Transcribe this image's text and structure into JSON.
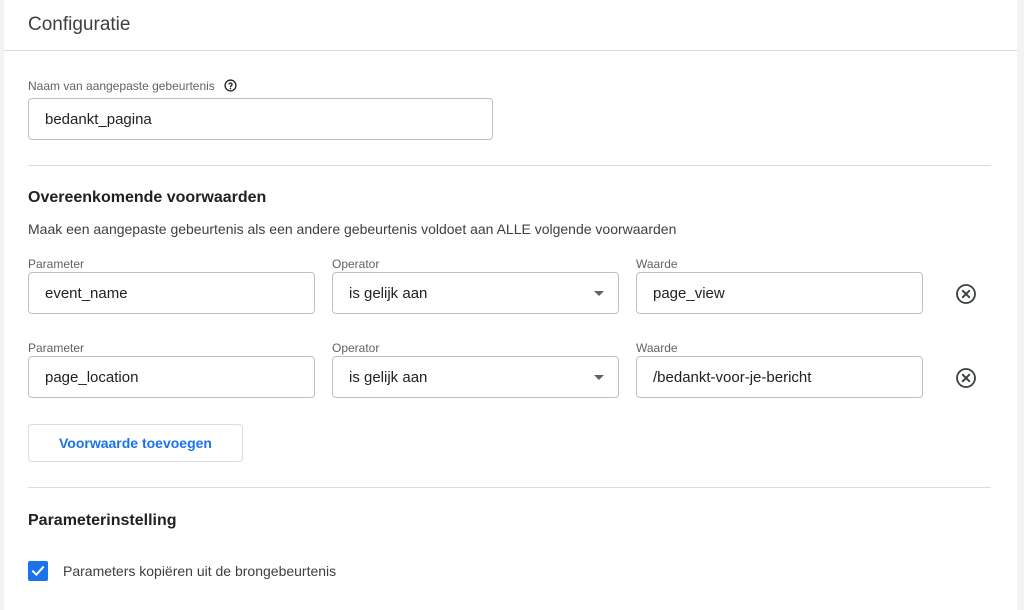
{
  "header": {
    "title": "Configuratie"
  },
  "event_name": {
    "label": "Naam van aangepaste gebeurtenis",
    "value": "bedankt_pagina"
  },
  "conditions": {
    "title": "Overeenkomende voorwaarden",
    "description": "Maak een aangepaste gebeurtenis als een andere gebeurtenis voldoet aan ALLE volgende voorwaarden",
    "rows": [
      {
        "parameter_label": "Parameter",
        "parameter_value": "event_name",
        "operator_label": "Operator",
        "operator_value": "is gelijk aan",
        "value_label": "Waarde",
        "value_value": "page_view"
      },
      {
        "parameter_label": "Parameter",
        "parameter_value": "page_location",
        "operator_label": "Operator",
        "operator_value": "is gelijk aan",
        "value_label": "Waarde",
        "value_value": "/bedankt-voor-je-bericht"
      }
    ],
    "add_button": "Voorwaarde toevoegen"
  },
  "parameter_settings": {
    "title": "Parameterinstelling",
    "copy_checkbox_label": "Parameters kopiëren uit de brongebeurtenis",
    "copy_checked": true
  },
  "icons": {
    "help": "help-circle-icon",
    "remove": "cancel-circle-icon",
    "check": "check-icon",
    "dropdown": "dropdown-arrow-icon"
  },
  "colors": {
    "accent": "#1a73e8",
    "border": "#bdc1c6",
    "divider": "#dadce0"
  }
}
